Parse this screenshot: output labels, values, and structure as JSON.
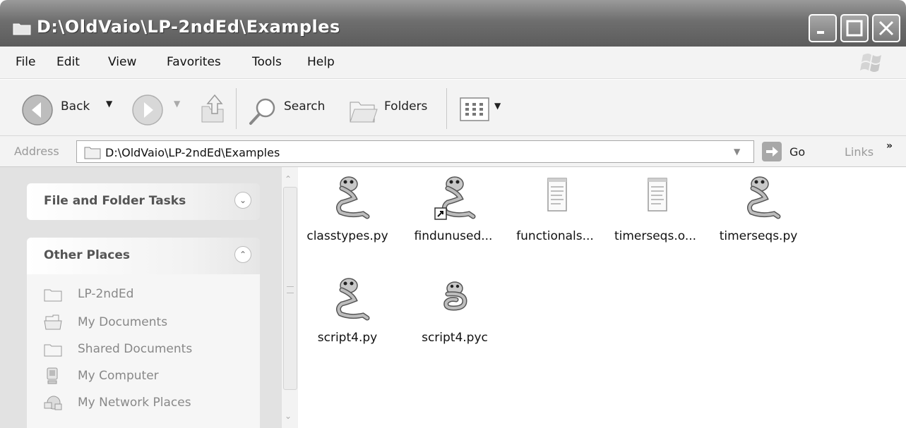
{
  "window": {
    "title": "D:\\OldVaio\\LP-2ndEd\\Examples",
    "icon": "folder-icon"
  },
  "menu": {
    "items": [
      "File",
      "Edit",
      "View",
      "Favorites",
      "Tools",
      "Help"
    ]
  },
  "toolbar": {
    "back_label": "Back",
    "search_label": "Search",
    "folders_label": "Folders"
  },
  "address": {
    "label": "Address",
    "value": "D:\\OldVaio\\LP-2ndEd\\Examples",
    "go_label": "Go",
    "links_label": "Links",
    "links_chevron": "»"
  },
  "taskpane": {
    "file_tasks_title": "File and Folder Tasks",
    "other_places_title": "Other Places",
    "places": [
      {
        "label": "LP-2ndEd",
        "icon": "folder-icon"
      },
      {
        "label": "My Documents",
        "icon": "my-documents-icon"
      },
      {
        "label": "Shared Documents",
        "icon": "folder-icon"
      },
      {
        "label": "My Computer",
        "icon": "my-computer-icon"
      },
      {
        "label": "My Network Places",
        "icon": "network-places-icon"
      }
    ]
  },
  "files": [
    {
      "name": "classtypes.py",
      "icon": "python-file-icon"
    },
    {
      "name": "findunused...",
      "icon": "python-shortcut-icon"
    },
    {
      "name": "functionals...",
      "icon": "text-file-icon"
    },
    {
      "name": "timerseqs.o...",
      "icon": "text-file-icon"
    },
    {
      "name": "timerseqs.py",
      "icon": "python-file-icon"
    },
    {
      "name": "script4.py",
      "icon": "python-file-icon"
    },
    {
      "name": "script4.pyc",
      "icon": "python-compiled-icon"
    }
  ],
  "colors": {
    "titlebar": "#6e6e6e",
    "taskpane": "#e2e2e2"
  }
}
